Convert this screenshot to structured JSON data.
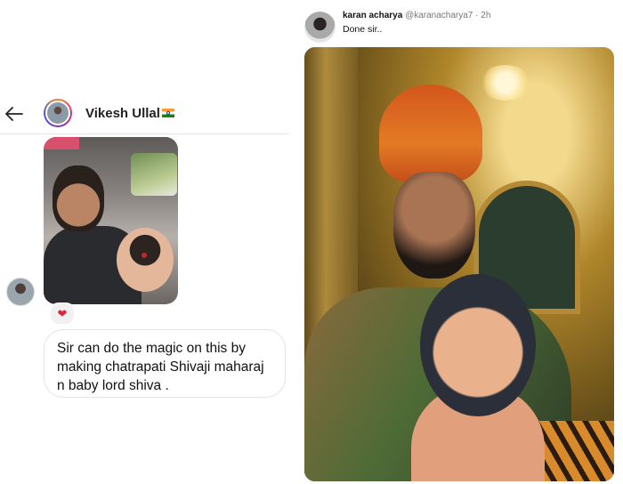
{
  "chat": {
    "contact_name": "Vikesh Ullal",
    "back_icon": "arrow-left-icon",
    "flag_icon": "india-flag-icon",
    "reaction_icon": "red-heart",
    "message_text": "Sir can do the magic on this by making chatrapati Shivaji maharaj n baby lord shiva ."
  },
  "tweet": {
    "display_name": "karan acharya",
    "handle": "@karanacharya7",
    "separator": " · ",
    "time": "2h",
    "text": "Done sir.."
  },
  "colors": {
    "heart": "#e0243a",
    "story_ring": "#dd2a7b",
    "handle_gray": "#777777"
  }
}
